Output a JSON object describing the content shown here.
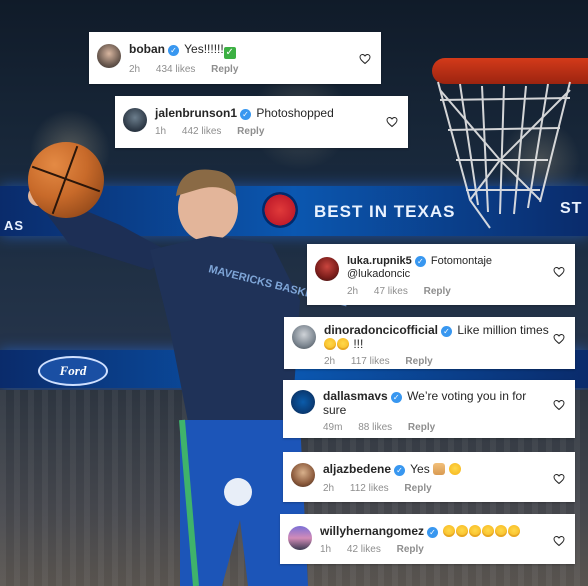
{
  "comments": [
    {
      "username": "boban",
      "text": "Yes!!!!!!",
      "emoji": [
        "check-mark"
      ],
      "time": "2h",
      "likes": "434 likes",
      "reply": "Reply"
    },
    {
      "username": "jalenbrunson1",
      "text": "Photoshopped",
      "emoji": [],
      "time": "1h",
      "likes": "442 likes",
      "reply": "Reply"
    },
    {
      "username": "luka.rupnik5",
      "text": "Fotomontaje @lukadoncic",
      "emoji": [],
      "time": "2h",
      "likes": "47 likes",
      "reply": "Reply"
    },
    {
      "username": "dinoradoncicofficial",
      "text": "Like million times",
      "text2": "!!!",
      "emoji": [
        "face-with-tears-of-joy",
        "face-with-tears-of-joy"
      ],
      "time": "2h",
      "likes": "117 likes",
      "reply": "Reply"
    },
    {
      "username": "dallasmavs",
      "text": "We’re voting you in for sure",
      "emoji": [],
      "time": "49m",
      "likes": "88 likes",
      "reply": "Reply"
    },
    {
      "username": "aljazbedene",
      "text": "Yes",
      "emoji": [
        "folded-hands",
        "grinning-face"
      ],
      "time": "2h",
      "likes": "112 likes",
      "reply": "Reply"
    },
    {
      "username": "willyhernangomez",
      "text": "",
      "emoji": [
        "face-with-tears-of-joy",
        "face-with-tears-of-joy",
        "face-with-tears-of-joy",
        "face-with-tears-of-joy",
        "face-with-tears-of-joy",
        "face-with-tears-of-joy"
      ],
      "time": "1h",
      "likes": "42 likes",
      "reply": "Reply"
    }
  ],
  "background": {
    "arena_banner": "BEST IN TEXAS",
    "banner_edge": "AS",
    "banner_edge_right": "ST",
    "sponsor": "Ford",
    "jersey_text": "MAVERICKS BASKETBALL"
  },
  "colors": {
    "verified_badge": "#3897f0",
    "card_bg": "#ffffff",
    "username_text": "#262626",
    "meta_text": "#8e8e8e"
  },
  "icons": {
    "verified": "verified-badge-icon",
    "like": "heart-outline-icon"
  }
}
